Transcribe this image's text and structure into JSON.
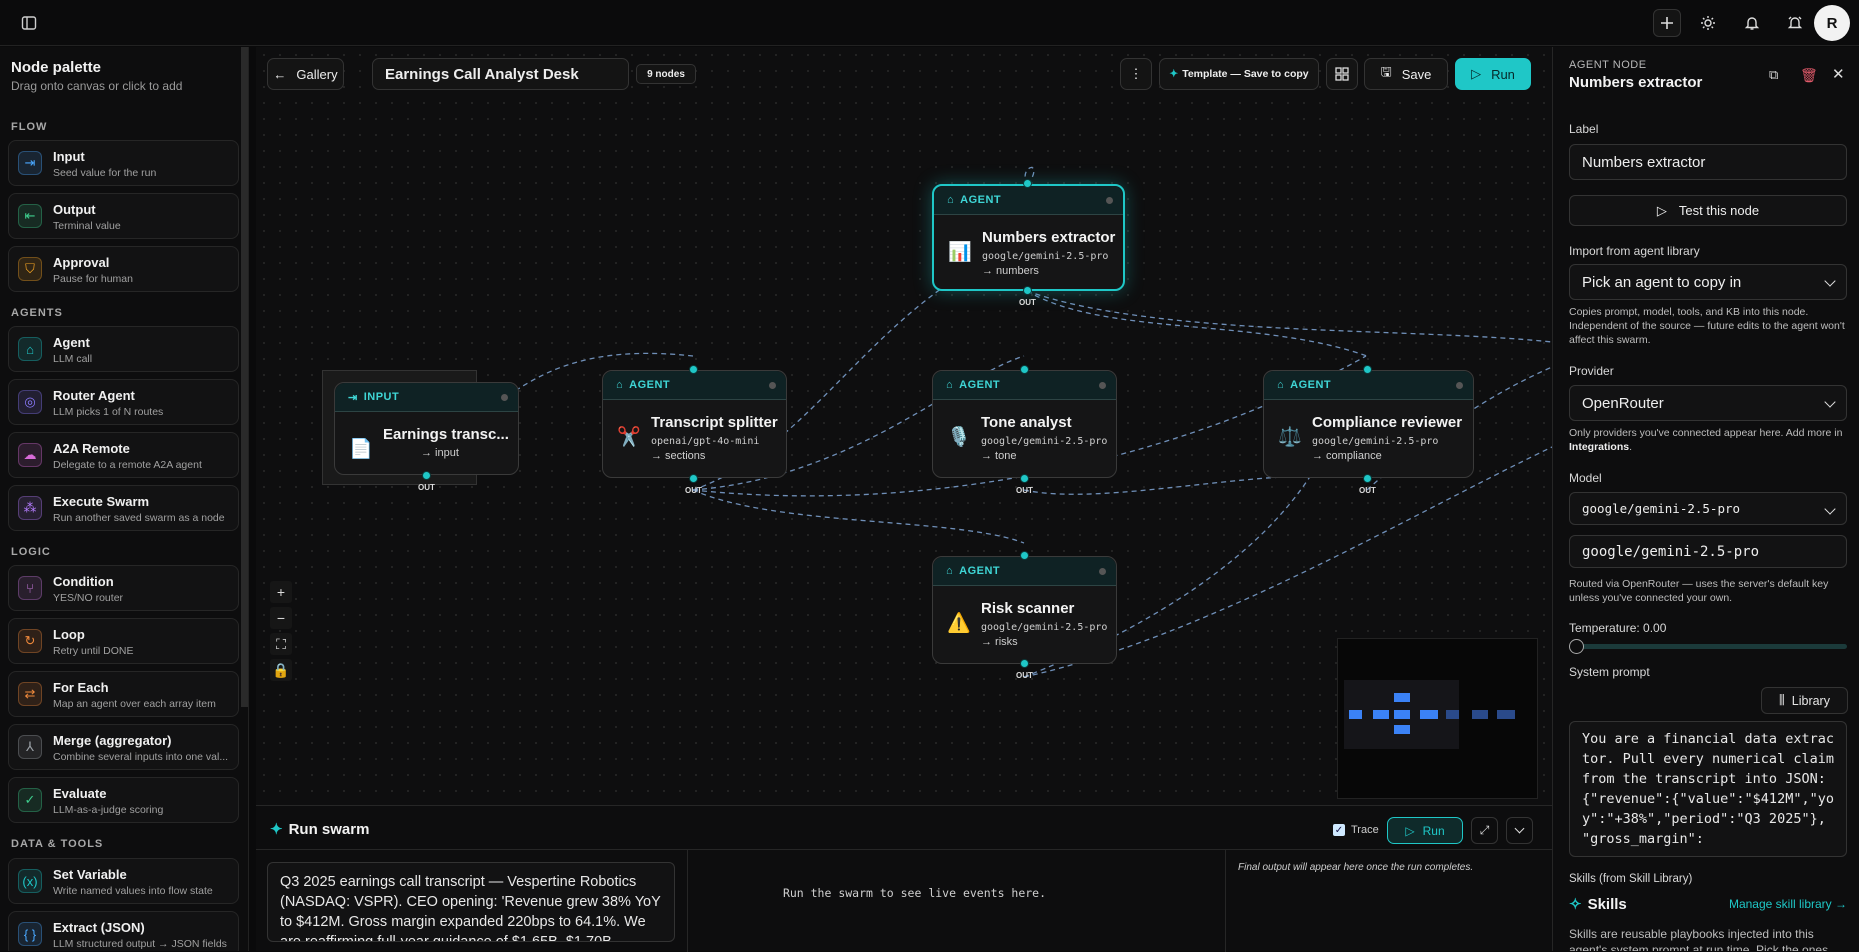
{
  "topbar": {
    "avatar_initial": "R"
  },
  "palette": {
    "title": "Node palette",
    "subtitle": "Drag onto canvas or click to add",
    "sections": {
      "flow": "FLOW",
      "agents": "AGENTS",
      "logic": "LOGIC",
      "data_tools": "DATA & TOOLS"
    },
    "items": [
      {
        "name": "Input",
        "desc": "Seed value for the run",
        "icon": "input-icon",
        "glyph": "⇥",
        "color": "#4aa8ff"
      },
      {
        "name": "Output",
        "desc": "Terminal value",
        "icon": "output-icon",
        "glyph": "⇤",
        "color": "#3ecf8e"
      },
      {
        "name": "Approval",
        "desc": "Pause for human",
        "icon": "shield-icon",
        "glyph": "⛉",
        "color": "#f5a524"
      },
      {
        "name": "Agent",
        "desc": "LLM call",
        "icon": "robot-icon",
        "glyph": "⌂",
        "color": "#1fc7c7"
      },
      {
        "name": "Router Agent",
        "desc": "LLM picks 1 of N routes",
        "icon": "compass-icon",
        "glyph": "◎",
        "color": "#8b7bff"
      },
      {
        "name": "A2A Remote",
        "desc": "Delegate to a remote A2A agent",
        "icon": "cloud-icon",
        "glyph": "☁",
        "color": "#d86bd8"
      },
      {
        "name": "Execute Swarm",
        "desc": "Run another saved swarm as a node",
        "icon": "swarm-icon",
        "glyph": "⁂",
        "color": "#b57cff"
      },
      {
        "name": "Condition",
        "desc": "YES/NO router",
        "icon": "branch-icon",
        "glyph": "⑂",
        "color": "#c678dd"
      },
      {
        "name": "Loop",
        "desc": "Retry until DONE",
        "icon": "loop-icon",
        "glyph": "↻",
        "color": "#f08a3c"
      },
      {
        "name": "For Each",
        "desc": "Map an agent over each array item",
        "icon": "repeat-icon",
        "glyph": "⇄",
        "color": "#f08a3c"
      },
      {
        "name": "Merge (aggregator)",
        "desc": "Combine several inputs into one val...",
        "icon": "merge-icon",
        "glyph": "⅄",
        "color": "#9aa0a6"
      },
      {
        "name": "Evaluate",
        "desc": "LLM-as-a-judge scoring",
        "icon": "clipboard-check-icon",
        "glyph": "✓",
        "color": "#3ecf8e"
      },
      {
        "name": "Set Variable",
        "desc": "Write named values into flow state",
        "icon": "variable-icon",
        "glyph": "(x)",
        "color": "#1fc7c7"
      },
      {
        "name": "Extract (JSON)",
        "desc": "LLM structured output → JSON fields",
        "icon": "braces-icon",
        "glyph": "{ }",
        "color": "#4aa8ff"
      }
    ]
  },
  "toolbar": {
    "gallery_label": "Gallery",
    "swarm_name": "Earnings Call Analyst Desk",
    "node_count": "9 nodes",
    "template_label": "Template — Save to copy",
    "save_label": "Save",
    "run_label": "Run"
  },
  "nodes": {
    "input": {
      "type": "INPUT",
      "title": "Earnings transc...",
      "out": "→ input",
      "emoji": "📄"
    },
    "splitter": {
      "type": "AGENT",
      "title": "Transcript splitter",
      "model": "openai/gpt-4o-mini",
      "out": "→ sections",
      "emoji": "✂️"
    },
    "numbers": {
      "type": "AGENT",
      "title": "Numbers extractor",
      "model": "google/gemini-2.5-pro",
      "out": "→ numbers",
      "emoji": "📊"
    },
    "tone": {
      "type": "AGENT",
      "title": "Tone analyst",
      "model": "google/gemini-2.5-pro",
      "out": "→ tone",
      "emoji": "🎙️"
    },
    "compliance": {
      "type": "AGENT",
      "title": "Compliance reviewer",
      "model": "google/gemini-2.5-pro",
      "out": "→ compliance",
      "emoji": "⚖️"
    },
    "risk": {
      "type": "AGENT",
      "title": "Risk scanner",
      "model": "google/gemini-2.5-pro",
      "out": "→ risks",
      "emoji": "⚠️"
    },
    "out_label": "OUT"
  },
  "run_panel": {
    "title": "Run swarm",
    "trace_label": "Trace",
    "run_label": "Run",
    "input_text": "Q3 2025 earnings call transcript — Vespertine Robotics (NASDAQ: VSPR). CEO opening: 'Revenue grew 38% YoY to $412M. Gross margin expanded 220bps to 64.1%. We are reaffirming full-year guidance of $1.65B–$1.70B",
    "events_placeholder": "Run the swarm to see live events here.",
    "output_placeholder": "Final output will appear here once the run completes."
  },
  "inspector": {
    "kicker": "AGENT NODE",
    "title": "Numbers extractor",
    "label_label": "Label",
    "label_value": "Numbers extractor",
    "test_label": "Test this node",
    "import_label": "Import from agent library",
    "import_placeholder": "Pick an agent to copy in",
    "import_hint": "Copies prompt, model, tools, and KB into this node. Independent of the source — future edits to the agent won't affect this swarm.",
    "provider_label": "Provider",
    "provider_value": "OpenRouter",
    "provider_hint_pre": "Only providers you've connected appear here. Add more in ",
    "provider_hint_link": "Integrations",
    "provider_hint_post": ".",
    "model_label": "Model",
    "model_select": "google/gemini-2.5-pro",
    "model_value": "google/gemini-2.5-pro",
    "model_hint": "Routed via OpenRouter — uses the server's default key unless you've connected your own.",
    "temperature_label": "Temperature: 0.00",
    "temperature": 0.0,
    "system_prompt_label": "System prompt",
    "library_label": "Library",
    "system_prompt": "You are a financial data extractor. Pull every numerical claim from the transcript into JSON: {\"revenue\":{\"value\":\"$412M\",\"yoy\":\"+38%\",\"period\":\"Q3 2025\"},\n\"gross_margin\":",
    "skills_label": "Skills (from Skill Library)",
    "skills_title": "Skills",
    "manage_skills": "Manage skill library →",
    "skills_hint": "Skills are reusable playbooks injected into this agent's system prompt at run time. Pick the ones"
  },
  "colors": {
    "accent": "#1fc7c7",
    "edge": "#6f8fb8",
    "link": "#1fc7c7"
  }
}
